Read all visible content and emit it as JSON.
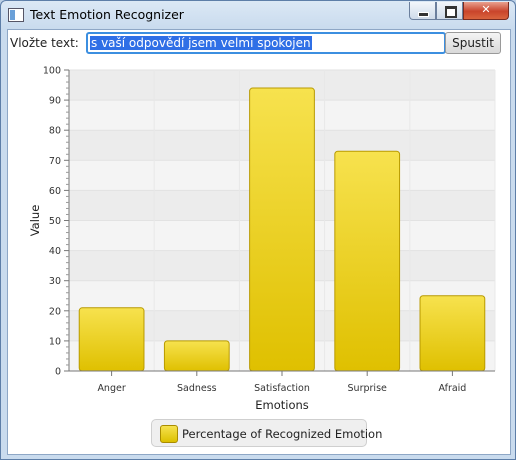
{
  "window": {
    "title": "Text Emotion Recognizer"
  },
  "form": {
    "prompt_label": "Vložte text:",
    "input_value": "s vaší odpovědí jsem velmi spokojen",
    "run_label": "Spustit"
  },
  "chart_data": {
    "type": "bar",
    "title": "",
    "xlabel": "Emotions",
    "ylabel": "Value",
    "ylim": [
      0,
      100
    ],
    "categories": [
      "Anger",
      "Sadness",
      "Satisfaction",
      "Surprise",
      "Afraid"
    ],
    "series": [
      {
        "name": "Percentage of Recognized Emotion",
        "values": [
          21,
          10,
          94,
          73,
          25
        ]
      }
    ],
    "yticks": [
      0,
      10,
      20,
      30,
      40,
      50,
      60,
      70,
      80,
      90,
      100
    ],
    "grid": true,
    "legend_position": "bottom",
    "bar_color": "#e8cb1a"
  }
}
